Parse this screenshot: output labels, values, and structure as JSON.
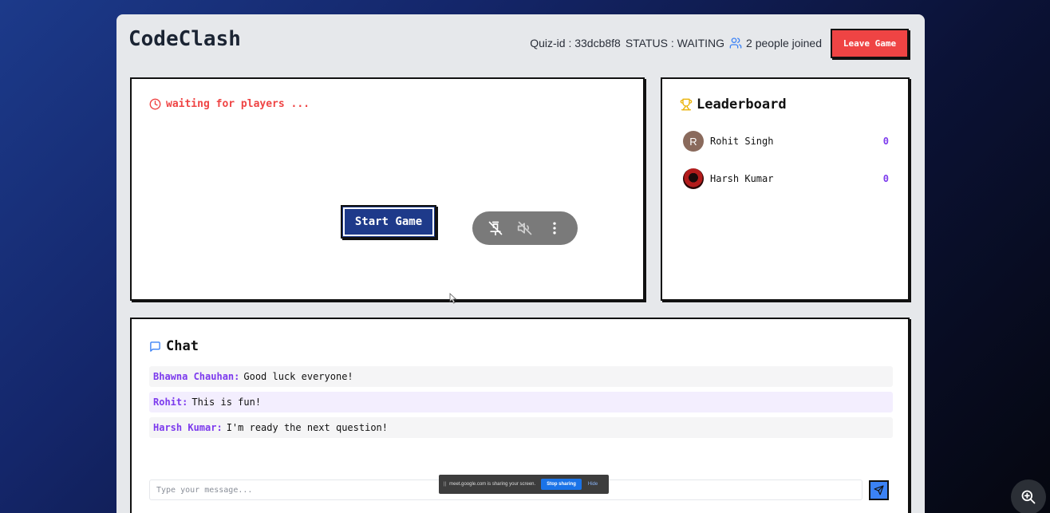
{
  "header": {
    "brand": "CodeClash",
    "quiz_id_text": "Quiz-id : 33dcb8f8",
    "status_text": "STATUS : WAITING",
    "people_text": "2 people joined",
    "leave_label": "Leave Game"
  },
  "game": {
    "status": "waiting for players ...",
    "start_label": "Start Game"
  },
  "leaderboard": {
    "title": "Leaderboard",
    "players": [
      {
        "initial": "R",
        "name": "Rohit Singh",
        "score": "0"
      },
      {
        "initial": "",
        "name": "Harsh Kumar",
        "score": "0"
      }
    ]
  },
  "chat": {
    "title": "Chat",
    "messages": [
      {
        "author": "Bhawna Chauhan:",
        "text": "Good luck everyone!"
      },
      {
        "author": "Rohit:",
        "text": "This is fun!"
      },
      {
        "author": "Harsh Kumar:",
        "text": "I'm ready the next question!"
      }
    ],
    "placeholder": "Type your message..."
  },
  "share_bar": {
    "text": "meet.google.com is sharing your screen.",
    "stop_label": "Stop sharing",
    "hide_label": "Hide"
  },
  "colors": {
    "accent_red": "#ef4444",
    "primary_navy": "#1e3a8a",
    "score_purple": "#7c3aed",
    "send_blue": "#3b82f6"
  },
  "icons": {
    "status": "clock-icon",
    "people": "users-icon",
    "leaderboard": "trophy-icon",
    "chat": "message-square-icon",
    "send": "send-icon",
    "pin": "pin-off-icon",
    "mute": "volume-off-icon",
    "more": "more-vertical-icon",
    "zoom": "zoom-in-icon"
  }
}
